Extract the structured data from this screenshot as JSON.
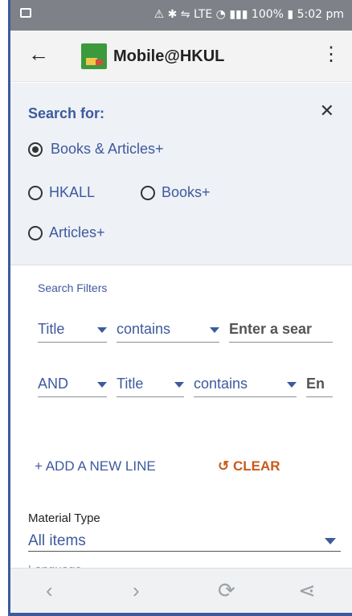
{
  "status_bar": {
    "battery": "100%",
    "time": "5:02 pm",
    "indicators": "⚠ ✱ ⇋ LTE ◔ ▮▮▮"
  },
  "toolbar": {
    "title": "Mobile@HKUL",
    "back_icon": "←",
    "menu_icon": "⋮"
  },
  "search_for": {
    "title": "Search for:",
    "close_icon": "✕",
    "options": [
      {
        "label": "Books & Articles+",
        "checked": true
      },
      {
        "label": "HKALL",
        "checked": false
      },
      {
        "label": "Books+",
        "checked": false
      },
      {
        "label": "Articles+",
        "checked": false
      }
    ]
  },
  "filters": {
    "label": "Search Filters",
    "row1": {
      "field": "Title",
      "operator": "contains",
      "placeholder": "Enter a sear"
    },
    "row2": {
      "boolean": "AND",
      "field": "Title",
      "operator": "contains",
      "placeholder": "En"
    }
  },
  "actions": {
    "add_line": "+ ADD A NEW LINE",
    "clear": "↺ CLEAR"
  },
  "material_type": {
    "label": "Material Type",
    "value": "All items"
  },
  "language_peek": "Language",
  "bottom_nav": {
    "back": "‹",
    "forward": "›",
    "refresh": "⟳",
    "share": "⋖"
  },
  "colors": {
    "accent": "#3d5a9e",
    "clear": "#c85a1a",
    "panel_bg": "#eef1f6"
  }
}
